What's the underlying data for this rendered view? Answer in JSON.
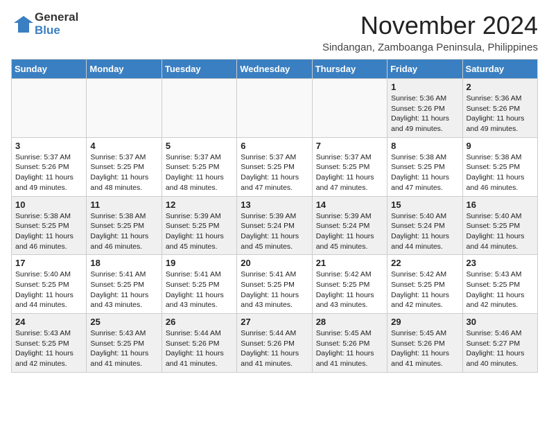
{
  "header": {
    "logo_general": "General",
    "logo_blue": "Blue",
    "month_title": "November 2024",
    "subtitle": "Sindangan, Zamboanga Peninsula, Philippines"
  },
  "weekdays": [
    "Sunday",
    "Monday",
    "Tuesday",
    "Wednesday",
    "Thursday",
    "Friday",
    "Saturday"
  ],
  "weeks": [
    [
      {
        "day": "",
        "info": ""
      },
      {
        "day": "",
        "info": ""
      },
      {
        "day": "",
        "info": ""
      },
      {
        "day": "",
        "info": ""
      },
      {
        "day": "",
        "info": ""
      },
      {
        "day": "1",
        "info": "Sunrise: 5:36 AM\nSunset: 5:26 PM\nDaylight: 11 hours\nand 49 minutes."
      },
      {
        "day": "2",
        "info": "Sunrise: 5:36 AM\nSunset: 5:26 PM\nDaylight: 11 hours\nand 49 minutes."
      }
    ],
    [
      {
        "day": "3",
        "info": "Sunrise: 5:37 AM\nSunset: 5:26 PM\nDaylight: 11 hours\nand 49 minutes."
      },
      {
        "day": "4",
        "info": "Sunrise: 5:37 AM\nSunset: 5:25 PM\nDaylight: 11 hours\nand 48 minutes."
      },
      {
        "day": "5",
        "info": "Sunrise: 5:37 AM\nSunset: 5:25 PM\nDaylight: 11 hours\nand 48 minutes."
      },
      {
        "day": "6",
        "info": "Sunrise: 5:37 AM\nSunset: 5:25 PM\nDaylight: 11 hours\nand 47 minutes."
      },
      {
        "day": "7",
        "info": "Sunrise: 5:37 AM\nSunset: 5:25 PM\nDaylight: 11 hours\nand 47 minutes."
      },
      {
        "day": "8",
        "info": "Sunrise: 5:38 AM\nSunset: 5:25 PM\nDaylight: 11 hours\nand 47 minutes."
      },
      {
        "day": "9",
        "info": "Sunrise: 5:38 AM\nSunset: 5:25 PM\nDaylight: 11 hours\nand 46 minutes."
      }
    ],
    [
      {
        "day": "10",
        "info": "Sunrise: 5:38 AM\nSunset: 5:25 PM\nDaylight: 11 hours\nand 46 minutes."
      },
      {
        "day": "11",
        "info": "Sunrise: 5:38 AM\nSunset: 5:25 PM\nDaylight: 11 hours\nand 46 minutes."
      },
      {
        "day": "12",
        "info": "Sunrise: 5:39 AM\nSunset: 5:25 PM\nDaylight: 11 hours\nand 45 minutes."
      },
      {
        "day": "13",
        "info": "Sunrise: 5:39 AM\nSunset: 5:24 PM\nDaylight: 11 hours\nand 45 minutes."
      },
      {
        "day": "14",
        "info": "Sunrise: 5:39 AM\nSunset: 5:24 PM\nDaylight: 11 hours\nand 45 minutes."
      },
      {
        "day": "15",
        "info": "Sunrise: 5:40 AM\nSunset: 5:24 PM\nDaylight: 11 hours\nand 44 minutes."
      },
      {
        "day": "16",
        "info": "Sunrise: 5:40 AM\nSunset: 5:25 PM\nDaylight: 11 hours\nand 44 minutes."
      }
    ],
    [
      {
        "day": "17",
        "info": "Sunrise: 5:40 AM\nSunset: 5:25 PM\nDaylight: 11 hours\nand 44 minutes."
      },
      {
        "day": "18",
        "info": "Sunrise: 5:41 AM\nSunset: 5:25 PM\nDaylight: 11 hours\nand 43 minutes."
      },
      {
        "day": "19",
        "info": "Sunrise: 5:41 AM\nSunset: 5:25 PM\nDaylight: 11 hours\nand 43 minutes."
      },
      {
        "day": "20",
        "info": "Sunrise: 5:41 AM\nSunset: 5:25 PM\nDaylight: 11 hours\nand 43 minutes."
      },
      {
        "day": "21",
        "info": "Sunrise: 5:42 AM\nSunset: 5:25 PM\nDaylight: 11 hours\nand 43 minutes."
      },
      {
        "day": "22",
        "info": "Sunrise: 5:42 AM\nSunset: 5:25 PM\nDaylight: 11 hours\nand 42 minutes."
      },
      {
        "day": "23",
        "info": "Sunrise: 5:43 AM\nSunset: 5:25 PM\nDaylight: 11 hours\nand 42 minutes."
      }
    ],
    [
      {
        "day": "24",
        "info": "Sunrise: 5:43 AM\nSunset: 5:25 PM\nDaylight: 11 hours\nand 42 minutes."
      },
      {
        "day": "25",
        "info": "Sunrise: 5:43 AM\nSunset: 5:25 PM\nDaylight: 11 hours\nand 41 minutes."
      },
      {
        "day": "26",
        "info": "Sunrise: 5:44 AM\nSunset: 5:26 PM\nDaylight: 11 hours\nand 41 minutes."
      },
      {
        "day": "27",
        "info": "Sunrise: 5:44 AM\nSunset: 5:26 PM\nDaylight: 11 hours\nand 41 minutes."
      },
      {
        "day": "28",
        "info": "Sunrise: 5:45 AM\nSunset: 5:26 PM\nDaylight: 11 hours\nand 41 minutes."
      },
      {
        "day": "29",
        "info": "Sunrise: 5:45 AM\nSunset: 5:26 PM\nDaylight: 11 hours\nand 41 minutes."
      },
      {
        "day": "30",
        "info": "Sunrise: 5:46 AM\nSunset: 5:27 PM\nDaylight: 11 hours\nand 40 minutes."
      }
    ]
  ]
}
